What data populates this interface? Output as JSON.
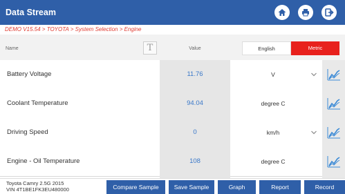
{
  "header": {
    "title": "Data Stream",
    "icons": [
      "home-icon",
      "print-icon",
      "exit-icon"
    ]
  },
  "breadcrumb": "DEMO V15.54 > TOYOTA > System Selection > Engine",
  "columns": {
    "name": "Name",
    "t_button": "T",
    "value": "Value",
    "english": "English",
    "metric": "Metric"
  },
  "colors": {
    "header": "#2f5fa8",
    "metric_active": "#e8211d",
    "value_text": "#3a78c9"
  },
  "rows": [
    {
      "name": "Battery Voltage",
      "value": "11.76",
      "unit": "V",
      "has_dropdown": true
    },
    {
      "name": "Coolant Temperature",
      "value": "94.04",
      "unit": "degree C",
      "has_dropdown": false
    },
    {
      "name": "Driving Speed",
      "value": "0",
      "unit": "km/h",
      "has_dropdown": true
    },
    {
      "name": "Engine - Oil Temperature",
      "value": "108",
      "unit": "degree C",
      "has_dropdown": false
    }
  ],
  "vehicle": {
    "model": "Toyota Camry 2.5G 2015",
    "vin": "VIN 4T1BE1FK3EU480000"
  },
  "footer_buttons": [
    "Compare Sample",
    "Save Sample",
    "Graph",
    "Report",
    "Record"
  ]
}
